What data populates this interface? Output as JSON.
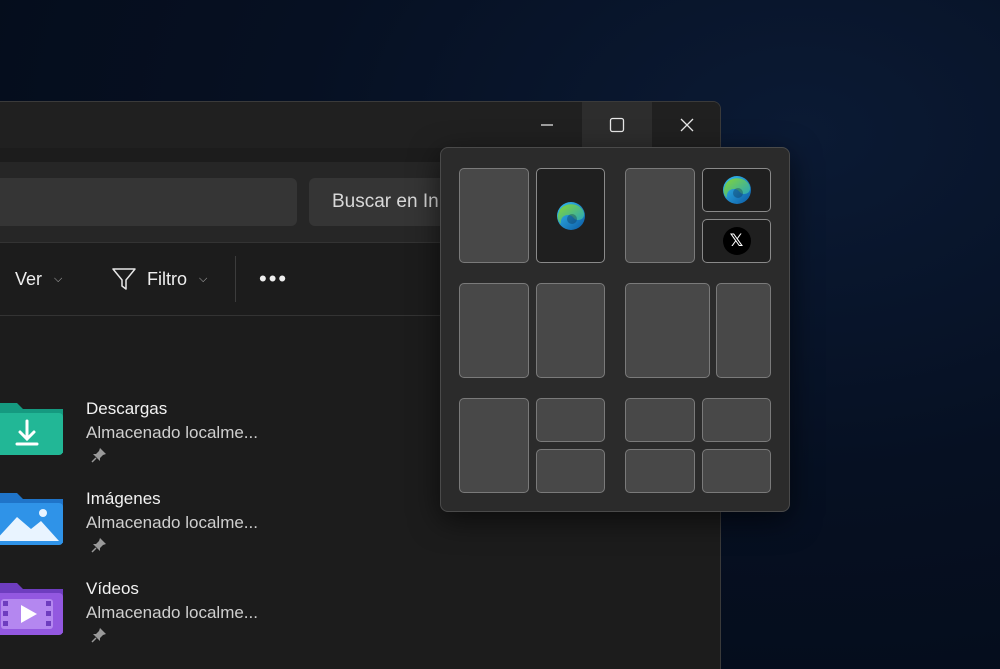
{
  "window": {
    "caption": {
      "minimize_icon": "minimize-icon",
      "maximize_icon": "maximize-icon",
      "close_icon": "close-icon"
    },
    "search": {
      "placeholder": "Buscar en In"
    },
    "toolbar": {
      "view_label": "Ver",
      "filter_label": "Filtro",
      "more_label": "•••"
    },
    "files": [
      {
        "name": "Descargas",
        "subtitle": "Almacenado localme...",
        "icon": "downloads-folder-icon",
        "color": "#1fa88f"
      },
      {
        "name": "Imágenes",
        "subtitle": "Almacenado localme...",
        "icon": "pictures-folder-icon",
        "color": "#2d8ae0"
      },
      {
        "name": "Vídeos",
        "subtitle": "Almacenado localme...",
        "icon": "videos-folder-icon",
        "color": "#8a4fd8"
      }
    ]
  },
  "snap_layouts": {
    "filled_apps": [
      "edge-icon",
      "edge-icon",
      "x-icon"
    ],
    "x_logo_text": "𝕏"
  },
  "colors": {
    "window_bg": "#1c1c1c",
    "flyout_bg": "#2b2b2b",
    "zone_bg": "#484848"
  }
}
